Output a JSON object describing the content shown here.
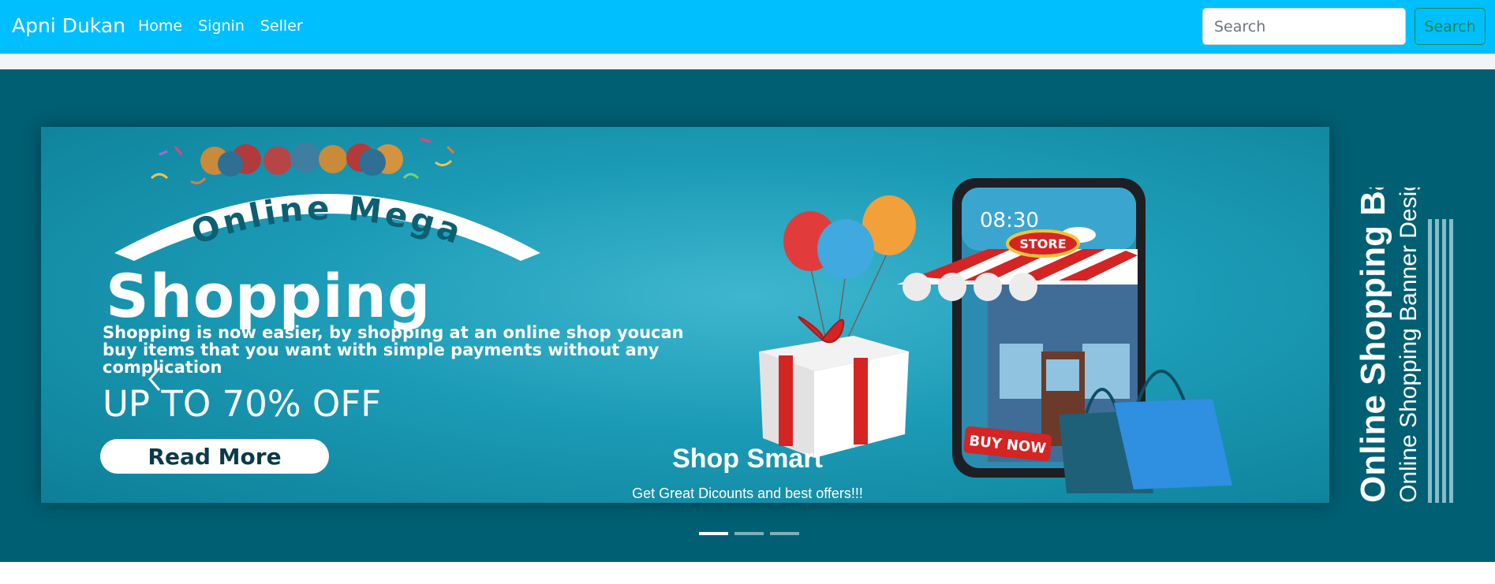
{
  "navbar": {
    "brand": "Apni Dukan",
    "links": [
      "Home",
      "Signin",
      "Seller"
    ],
    "search_placeholder": "Search",
    "search_button": "Search"
  },
  "banner": {
    "headline_arc": "Online Mega",
    "headline": "Shopping",
    "description": "Shopping is now easier, by shopping at an online shop youcan buy items that you want with simple payments without any complication",
    "offer": "UP TO 70% OFF",
    "cta": "Read More",
    "phone_time": "08:30",
    "store_sign": "STORE",
    "buy_now": "BUY NOW",
    "side_title": "Online Shopping Banner",
    "side_subtitle": "Online Shopping Banner Design"
  },
  "caption": {
    "title": "Shop Smart",
    "subtitle": "Get Great Dicounts and best offers!!!"
  },
  "carousel": {
    "slide_count": 3,
    "active_index": 0
  },
  "colors": {
    "navbar": "#00bfff",
    "carousel_bg": "#005f73",
    "button_outline": "#198754"
  }
}
